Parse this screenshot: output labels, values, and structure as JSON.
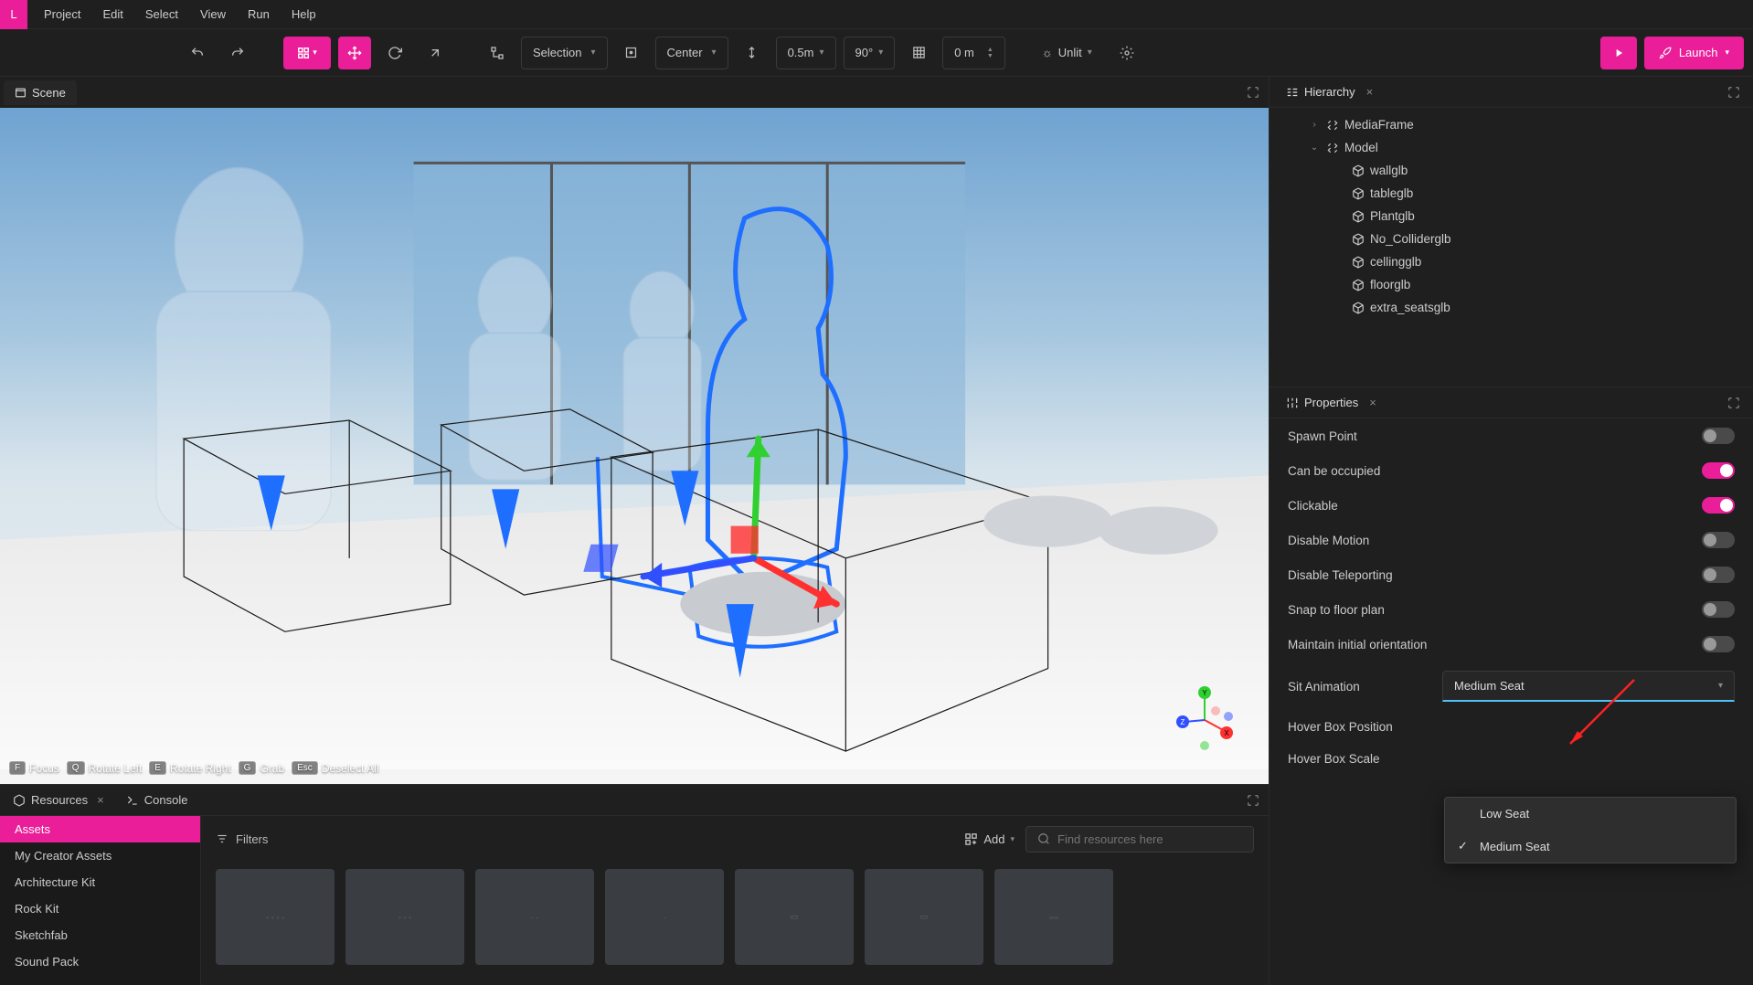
{
  "app": {
    "logo_letter": "L"
  },
  "menus": [
    "Project",
    "Edit",
    "Select",
    "View",
    "Run",
    "Help"
  ],
  "toolbar": {
    "selection_label": "Selection",
    "center_label": "Center",
    "snap_distance": "0.5m",
    "snap_angle": "90°",
    "grid_value": "0 m",
    "lighting_label": "Unlit",
    "launch_label": "Launch"
  },
  "scene_tab": "Scene",
  "viewport_hints": [
    {
      "key": "F",
      "label": "Focus"
    },
    {
      "key": "Q",
      "label": "Rotate Left"
    },
    {
      "key": "E",
      "label": "Rotate Right"
    },
    {
      "key": "G",
      "label": "Grab"
    },
    {
      "key": "Esc",
      "label": "Deselect All"
    }
  ],
  "bottom_tabs": {
    "resources": "Resources",
    "console": "Console"
  },
  "resources_sidebar": [
    "Assets",
    "My Creator Assets",
    "Architecture Kit",
    "Rock Kit",
    "Sketchfab",
    "Sound Pack"
  ],
  "resources": {
    "filters_label": "Filters",
    "add_label": "Add",
    "search_placeholder": "Find resources here"
  },
  "hierarchy": {
    "title": "Hierarchy",
    "items": [
      {
        "indent": 2,
        "chev": "›",
        "icon": "group",
        "label": "MediaFrame"
      },
      {
        "indent": 2,
        "chev": "⌄",
        "icon": "group",
        "label": "Model"
      },
      {
        "indent": 4,
        "chev": "",
        "icon": "cube",
        "label": "wallglb"
      },
      {
        "indent": 4,
        "chev": "",
        "icon": "cube",
        "label": "tableglb"
      },
      {
        "indent": 4,
        "chev": "",
        "icon": "cube",
        "label": "Plantglb"
      },
      {
        "indent": 4,
        "chev": "",
        "icon": "cube",
        "label": "No_Colliderglb"
      },
      {
        "indent": 4,
        "chev": "",
        "icon": "cube",
        "label": "cellingglb"
      },
      {
        "indent": 4,
        "chev": "",
        "icon": "cube",
        "label": "floorglb"
      },
      {
        "indent": 4,
        "chev": "",
        "icon": "cube",
        "label": "extra_seatsglb"
      }
    ]
  },
  "properties": {
    "title": "Properties",
    "rows": [
      {
        "label": "Spawn Point",
        "on": false
      },
      {
        "label": "Can be occupied",
        "on": true
      },
      {
        "label": "Clickable",
        "on": true
      },
      {
        "label": "Disable Motion",
        "on": false
      },
      {
        "label": "Disable Teleporting",
        "on": false
      },
      {
        "label": "Snap to floor plan",
        "on": false
      },
      {
        "label": "Maintain initial orientation",
        "on": false
      }
    ],
    "sit_animation": {
      "label": "Sit Animation",
      "value": "Medium Seat",
      "options": [
        "Low Seat",
        "Medium Seat"
      ]
    },
    "hover_box_position_label": "Hover Box Position",
    "hover_box_scale_label": "Hover Box Scale"
  }
}
